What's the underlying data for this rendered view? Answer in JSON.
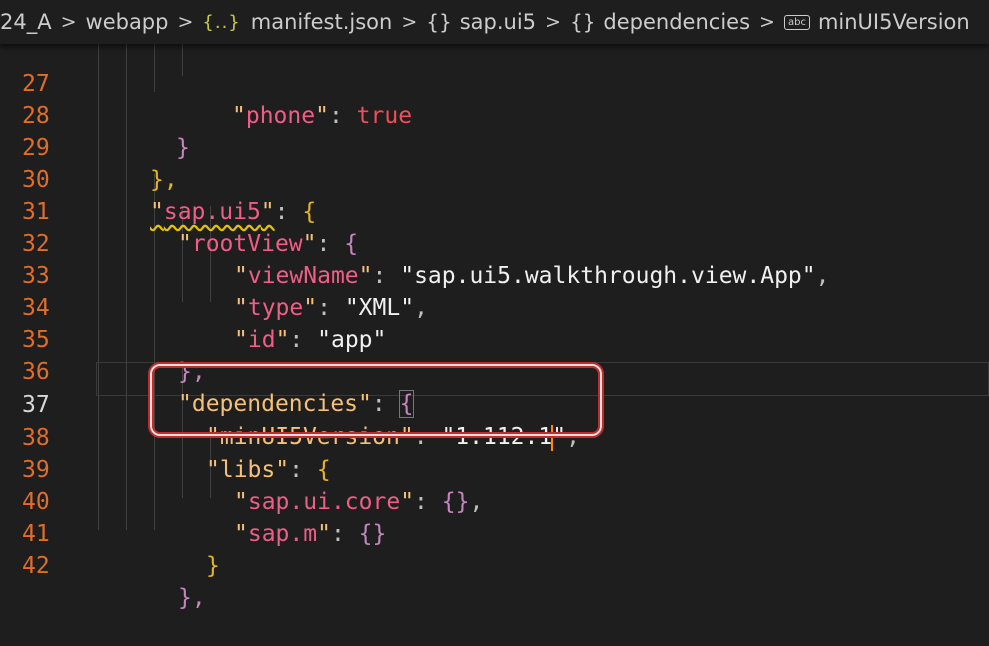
{
  "breadcrumb": {
    "items": [
      "24_A",
      "webapp",
      "manifest.json",
      "sap.ui5",
      "dependencies",
      "minUI5Version"
    ],
    "json_icon": "{..}",
    "obj_icon": "{}",
    "abc_icon": "abc"
  },
  "editor": {
    "active_line": 37,
    "lines": [
      {
        "n": "27",
        "t1": "\"",
        "key": "phone",
        "t2": "\": ",
        "val": "true"
      },
      {
        "n": "28",
        "b": "}"
      },
      {
        "n": "29",
        "b": "},"
      },
      {
        "n": "30",
        "key": "sap.ui5",
        "b": "{"
      },
      {
        "n": "31",
        "key": "rootView",
        "b": "{"
      },
      {
        "n": "32",
        "key": "viewName",
        "val": "sap.ui5.walkthrough.view.App"
      },
      {
        "n": "33",
        "key": "type",
        "val": "XML"
      },
      {
        "n": "34",
        "key": "id",
        "val": "app"
      },
      {
        "n": "35",
        "b": "},"
      },
      {
        "n": "36",
        "key": "dependencies",
        "b": "{"
      },
      {
        "n": "37",
        "key": "minUI5Version",
        "val": "1.112.1"
      },
      {
        "n": "38",
        "key": "libs",
        "b": "{"
      },
      {
        "n": "39",
        "key": "sap.ui.core",
        "b": "{}"
      },
      {
        "n": "40",
        "key": "sap.m",
        "b": "{}"
      },
      {
        "n": "41",
        "b": "}"
      },
      {
        "n": "42",
        "b": "},"
      }
    ]
  }
}
